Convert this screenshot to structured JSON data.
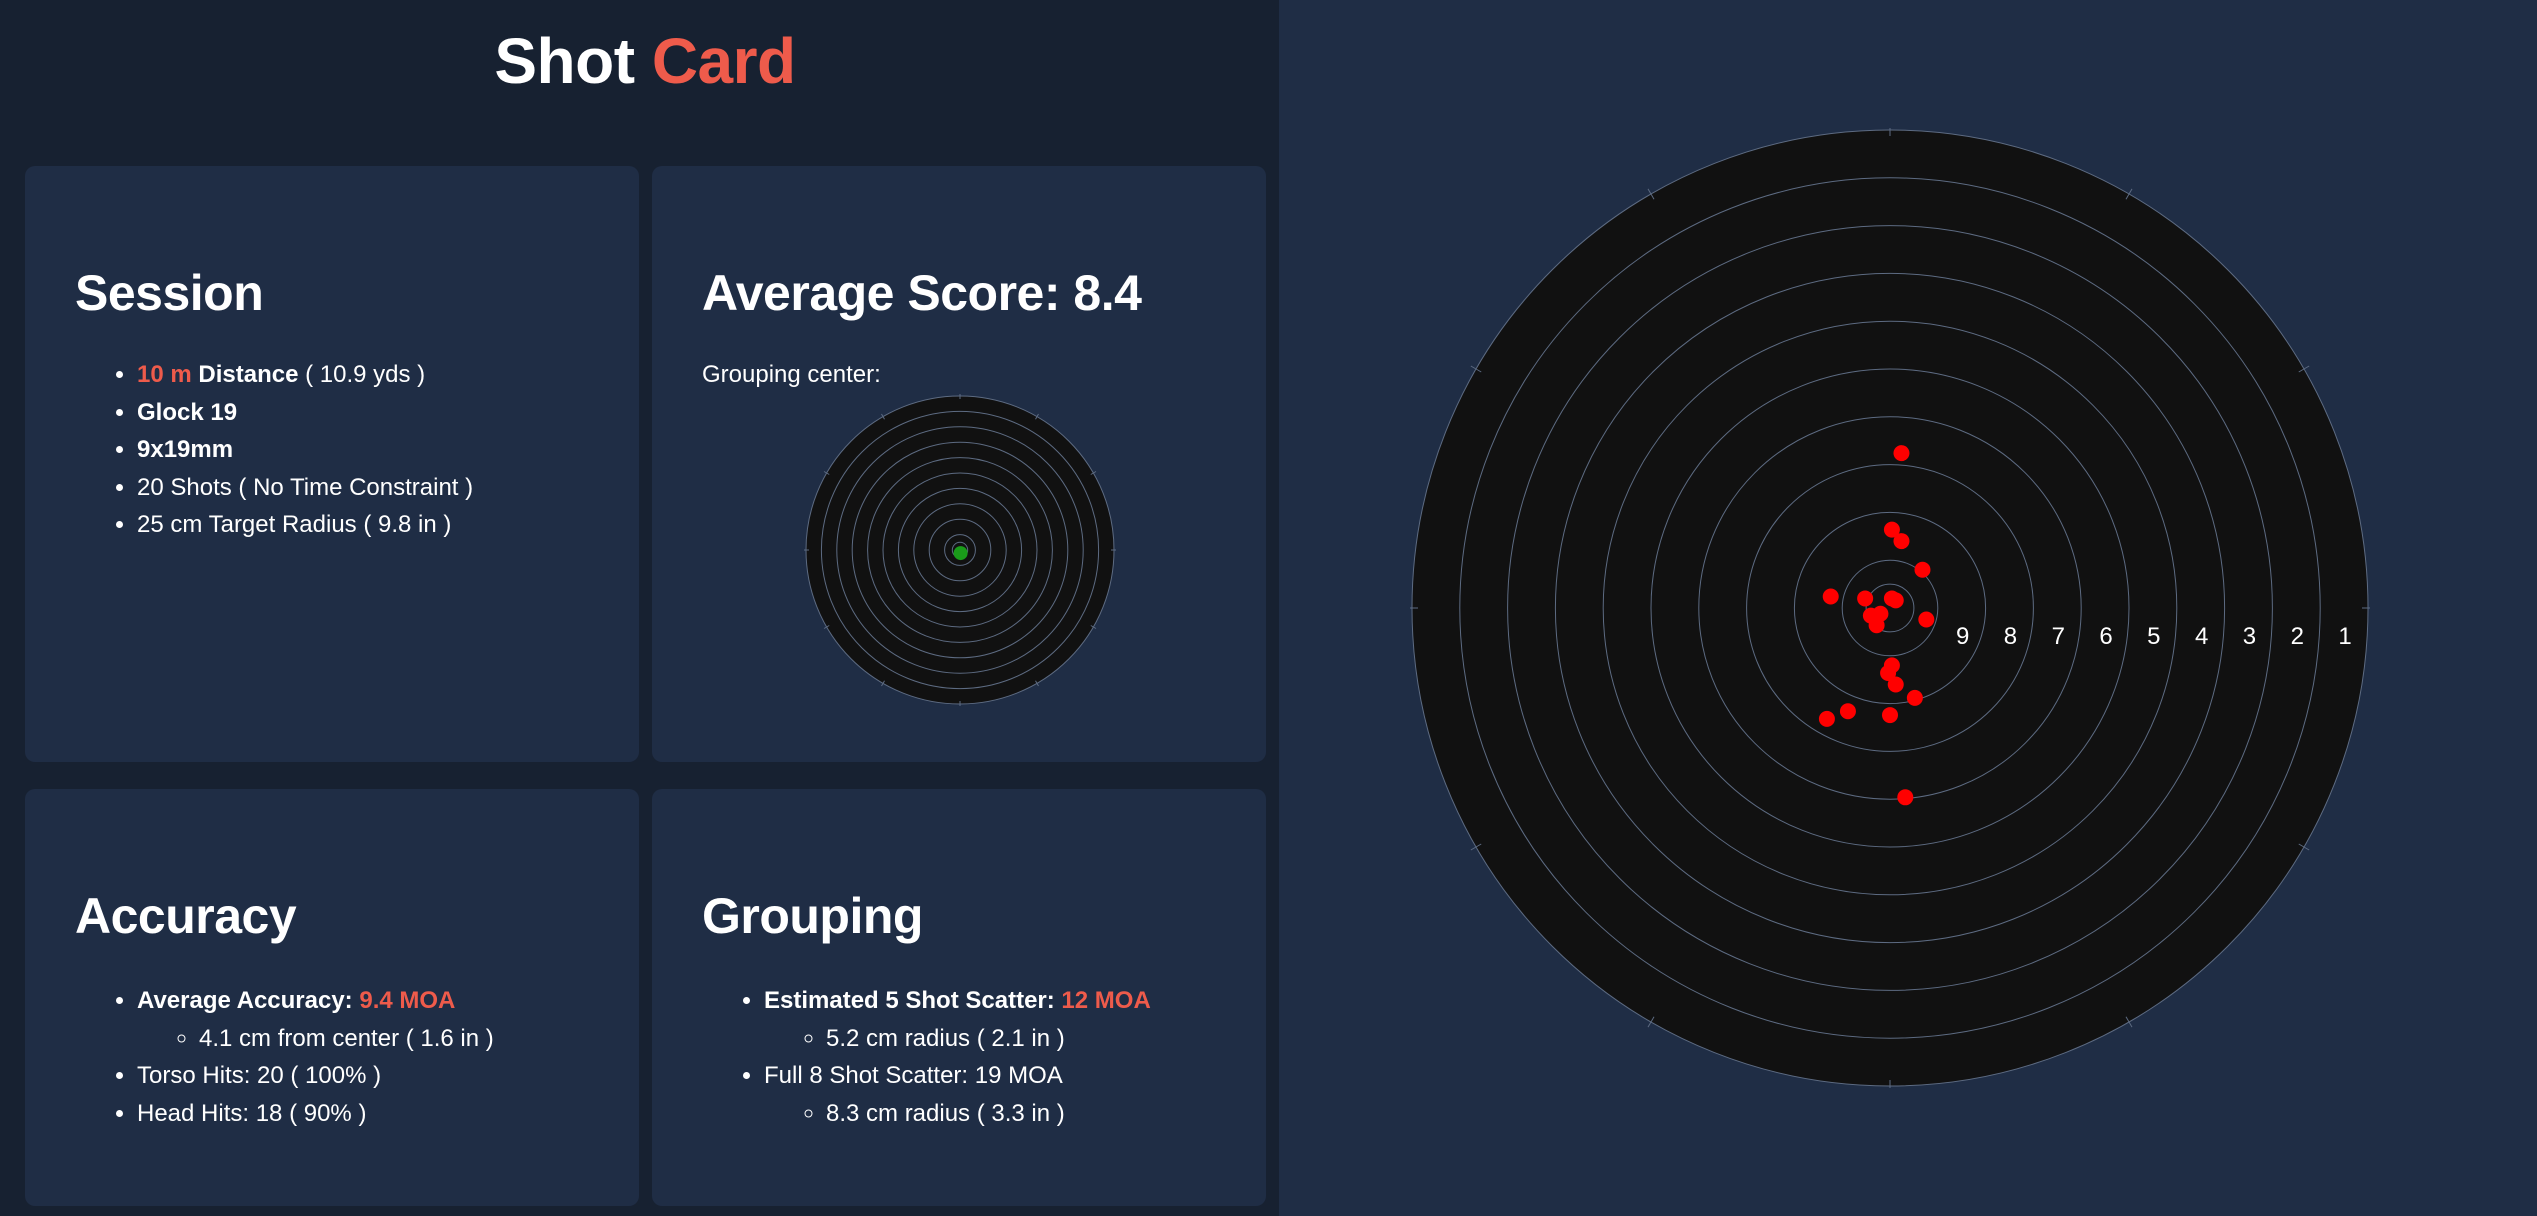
{
  "header": {
    "title_part1": "Shot",
    "title_part2": "Card"
  },
  "session": {
    "heading": "Session",
    "distance_value": "10 m",
    "distance_label": "Distance",
    "distance_yds": "( 10.9 yds )",
    "firearm": "Glock 19",
    "caliber": "9x19mm",
    "shots": "20 Shots ( No Time Constraint )",
    "target_radius": "25 cm Target Radius ( 9.8 in )"
  },
  "score": {
    "heading": "Average Score: 8.4",
    "grouping_center_label": "Grouping center:"
  },
  "accuracy": {
    "heading": "Accuracy",
    "avg_label": "Average Accuracy:",
    "avg_value": "9.4 MOA",
    "from_center": "4.1 cm from center ( 1.6 in )",
    "torso_hits": "Torso Hits: 20 ( 100% )",
    "head_hits": "Head Hits: 18 ( 90% )"
  },
  "grouping": {
    "heading": "Grouping",
    "est_label": "Estimated 5 Shot Scatter:",
    "est_value": "12 MOA",
    "est_radius": "5.2 cm radius ( 2.1 in )",
    "full_scatter": "Full 8 Shot Scatter: 19 MOA",
    "full_radius": "8.3 cm radius ( 3.3 in )"
  },
  "target": {
    "ring_labels": [
      "9",
      "8",
      "7",
      "6",
      "5",
      "4",
      "3",
      "2",
      "1"
    ],
    "colors": {
      "face": "#111111",
      "ring": "#5d6b82",
      "shot": "#ff0000",
      "center": "#1a9b1a",
      "accent": "#ee5b4b"
    },
    "grouping_center_cm": [
      0.1,
      -0.5
    ],
    "shots_cm": [
      [
        0.6,
        8.1
      ],
      [
        0.1,
        4.1
      ],
      [
        0.6,
        3.5
      ],
      [
        1.7,
        2.0
      ],
      [
        0.1,
        0.5
      ],
      [
        0.3,
        0.4
      ],
      [
        -0.5,
        -0.3
      ],
      [
        -3.1,
        0.6
      ],
      [
        -1.0,
        -0.4
      ],
      [
        1.9,
        -0.6
      ],
      [
        -0.7,
        -0.9
      ],
      [
        0.1,
        -3.0
      ],
      [
        -0.1,
        -3.4
      ],
      [
        0.3,
        -4.0
      ],
      [
        1.3,
        -4.7
      ],
      [
        -2.2,
        -5.4
      ],
      [
        0.0,
        -5.6
      ],
      [
        -3.3,
        -5.8
      ],
      [
        0.8,
        -9.9
      ],
      [
        -1.3,
        0.5
      ]
    ]
  }
}
